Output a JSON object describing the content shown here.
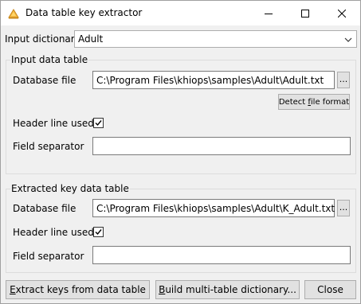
{
  "window": {
    "title": "Data table key extractor"
  },
  "input_dictionary": {
    "label": "Input dictionary",
    "value": "Adult"
  },
  "input_data_table": {
    "group_title": "Input data table",
    "database_file_label": "Database file",
    "database_file_value": "C:\\Program Files\\khiops\\samples\\Adult\\Adult.txt",
    "browse_label": "...",
    "detect_prefix": "Detect ",
    "detect_accel": "f",
    "detect_suffix": "ile format",
    "header_line_label": "Header line used",
    "header_line_checked": true,
    "field_separator_label": "Field separator",
    "field_separator_value": ""
  },
  "extracted_key_data_table": {
    "group_title": "Extracted key data table",
    "database_file_label": "Database file",
    "database_file_value": "C:\\Program Files\\khiops\\samples\\Adult\\K_Adult.txt",
    "browse_label": "...",
    "header_line_label": "Header line used",
    "header_line_checked": true,
    "field_separator_label": "Field separator",
    "field_separator_value": ""
  },
  "buttons": {
    "extract_accel": "E",
    "extract_rest": "xtract keys from data table",
    "build_accel": "B",
    "build_rest": "uild multi-table dictionary...",
    "close": "Close"
  },
  "icons": {
    "app": "khiops-app-icon",
    "minimize": "minimize-icon",
    "maximize": "maximize-icon",
    "close": "close-icon",
    "dropdown": "chevron-down-icon",
    "check": "checkmark-icon"
  }
}
